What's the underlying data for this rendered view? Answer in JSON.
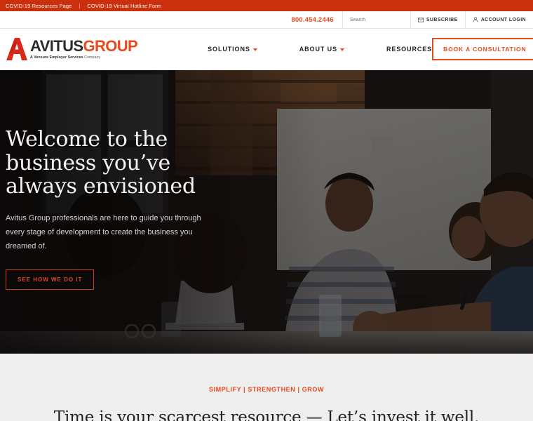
{
  "utility_bar": {
    "links": [
      {
        "label": "COVID-19 Resources Page"
      },
      {
        "label": "COVID-19 Virtual Hotline Form"
      }
    ],
    "separator": "|",
    "background": "#c9300b"
  },
  "secondary_bar": {
    "phone": "800.454.2446",
    "phone_color": "#e8491d",
    "search": {
      "placeholder": "Search.",
      "value": ""
    },
    "subscribe": {
      "label": "SUBSCRIBE",
      "icon": "envelope-icon"
    },
    "account_login": {
      "label": "ACCOUNT LOGIN",
      "icon": "user-icon"
    }
  },
  "header": {
    "logo": {
      "name_primary": "AVITUS",
      "name_secondary": "GROUP",
      "tagline_bold": "A Vensure Employer Services",
      "tagline_rest": " Company",
      "mark_color": "#d9291c",
      "primary_color": "#2b2b2b",
      "secondary_color": "#e8491d"
    },
    "nav": [
      {
        "label": "SOLUTIONS",
        "has_dropdown": true,
        "icon": "chevron-down-icon"
      },
      {
        "label": "ABOUT US",
        "has_dropdown": true,
        "icon": "chevron-down-icon"
      },
      {
        "label": "RESOURCES",
        "has_dropdown": false
      }
    ],
    "cta": {
      "label": "BOOK A CONSULTATION",
      "color": "#e8491d"
    }
  },
  "hero": {
    "title_line1": "Welcome to the",
    "title_line2": "business you’ve",
    "title_line3": "always envisioned",
    "subtext": "Avitus Group professionals are here to guide you through every stage of development to create the business you dreamed of.",
    "button_label": "SEE HOW WE DO IT",
    "button_color": "#d9472a",
    "image_description": "office-meeting-photo"
  },
  "promo": {
    "eyebrow": "SIMPLIFY | STRENGTHEN | GROW",
    "eyebrow_color": "#e8491d",
    "headline": "Time is your scarcest resource — Let’s invest it well.",
    "background": "#eeeeee"
  }
}
